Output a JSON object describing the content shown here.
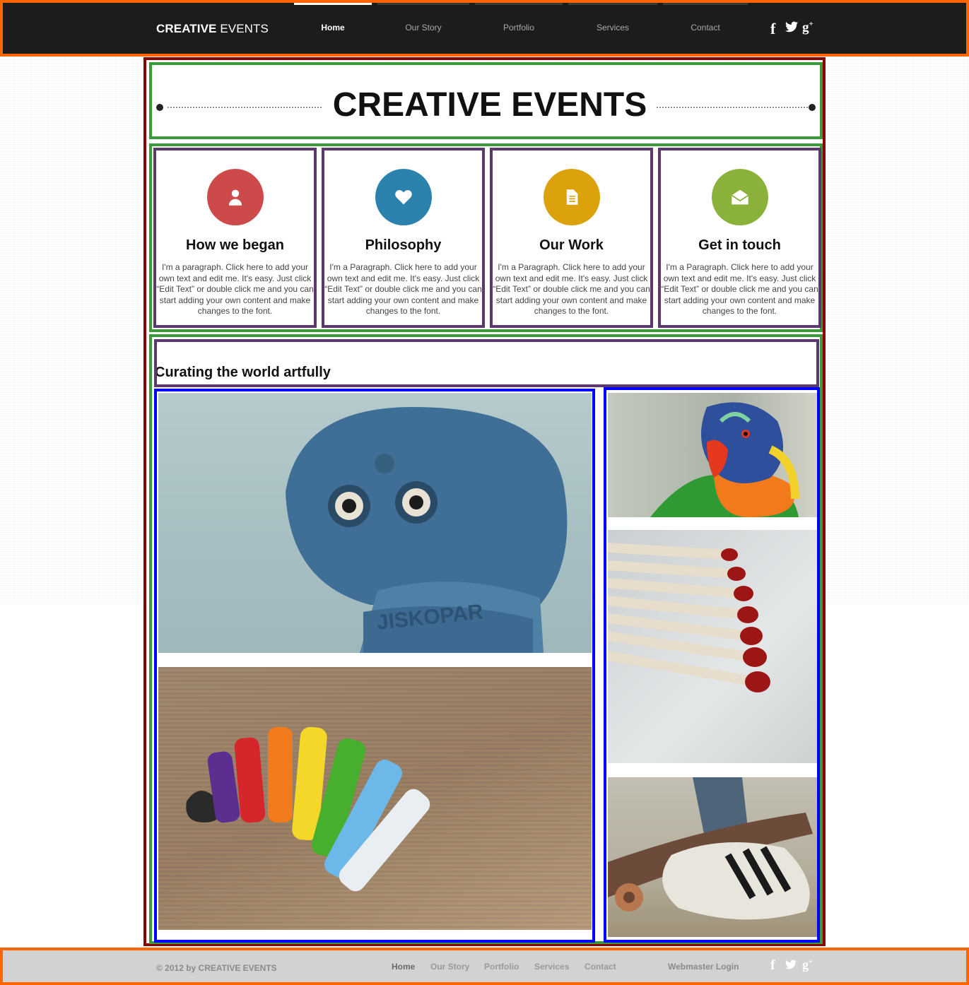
{
  "brand": {
    "bold": "CREATIVE",
    "light": " EVENTS"
  },
  "nav": [
    {
      "label": "Home",
      "active": true
    },
    {
      "label": "Our Story",
      "active": false
    },
    {
      "label": "Portfolio",
      "active": false
    },
    {
      "label": "Services",
      "active": false
    },
    {
      "label": "Contact",
      "active": false
    }
  ],
  "social": {
    "facebook": "f",
    "twitter": "twitter-bird-icon",
    "googleplus": "g+"
  },
  "hero": {
    "bold": "CREATIVE",
    "light": " EVENTS"
  },
  "features": [
    {
      "icon": "person-icon",
      "color": "#cc4a4a",
      "title": "How we began",
      "text": "I'm a paragraph. Click here to add your own text and edit me. It's easy. Just click “Edit Text” or double click me and you can start adding your own content and make changes to the font."
    },
    {
      "icon": "heart-icon",
      "color": "#2b82ad",
      "title": "Philosophy",
      "text": "I'm a Paragraph. Click here to add your own text and edit me. It's easy. Just click “Edit Text” or double click me and you can start adding your own content and make changes to the font."
    },
    {
      "icon": "document-icon",
      "color": "#dba20c",
      "title": "Our Work",
      "text": "I'm a Paragraph. Click here to add your own text and edit me. It's easy. Just click “Edit Text” or double click me and you can start adding your own content and make changes to the font."
    },
    {
      "icon": "envelope-icon",
      "color": "#8ab23a",
      "title": "Get in touch",
      "text": "I'm a Paragraph. Click here to add your own text and edit me. It's easy. Just click “Edit Text” or double click me and you can start adding your own content and make changes to the font."
    }
  ],
  "gallery": {
    "heading": "Curating the world artfully",
    "photos": [
      "coin-binocular-photo",
      "clay-rainbow-photo",
      "lorikeet-parrot-photo",
      "matchsticks-photo",
      "skateboard-sneaker-photo"
    ]
  },
  "footer": {
    "copyright": "© 2012 by CREATIVE EVENTS",
    "nav": [
      {
        "label": "Home",
        "active": true
      },
      {
        "label": "Our Story",
        "active": false
      },
      {
        "label": "Portfolio",
        "active": false
      },
      {
        "label": "Services",
        "active": false
      },
      {
        "label": "Contact",
        "active": false
      }
    ],
    "webmaster": "Webmaster Login"
  }
}
